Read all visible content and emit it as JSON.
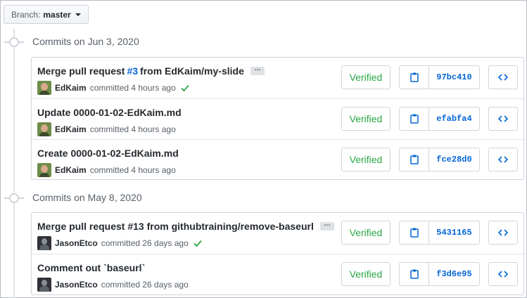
{
  "branch": {
    "label": "Branch:",
    "value": "master"
  },
  "groups": [
    {
      "title": "Commits on Jun 3, 2020",
      "commits": [
        {
          "message_pre": "Merge pull request",
          "issue": "#3",
          "message_post": "from EdKaim/my-slide",
          "has_ellipsis": true,
          "ellipsis": "…",
          "author": "EdKaim",
          "committed": "committed 4 hours ago",
          "check": true,
          "verified": "Verified",
          "sha": "97bc410",
          "avatar": "edkaim-avatar"
        },
        {
          "message": "Update 0000-01-02-EdKaim.md",
          "author": "EdKaim",
          "committed": "committed 4 hours ago",
          "verified": "Verified",
          "sha": "efabfa4",
          "avatar": "edkaim-avatar"
        },
        {
          "message": "Create 0000-01-02-EdKaim.md",
          "author": "EdKaim",
          "committed": "committed 4 hours ago",
          "verified": "Verified",
          "sha": "fce28d0",
          "avatar": "edkaim-avatar"
        }
      ]
    },
    {
      "title": "Commits on May 8, 2020",
      "commits": [
        {
          "message": "Merge pull request #13 from githubtraining/remove-baseurl",
          "has_ellipsis": true,
          "ellipsis": "…",
          "author": "JasonEtco",
          "committed": "committed 26 days ago",
          "check": true,
          "verified": "Verified",
          "sha": "5431165",
          "avatar": "jasonetco-avatar"
        },
        {
          "message": "Comment out `baseurl`",
          "author": "JasonEtco",
          "committed": "committed 26 days ago",
          "verified": "Verified",
          "sha": "f3d6e95",
          "avatar": "jasonetco-avatar"
        }
      ]
    }
  ],
  "icons": {
    "copy": "clipboard-icon",
    "browse": "code-icon",
    "status": "check-icon",
    "branch_dropdown": "caret-down-icon"
  },
  "colors": {
    "link": "#0366d6",
    "verified": "#28a745",
    "border": "#d1d5da"
  }
}
